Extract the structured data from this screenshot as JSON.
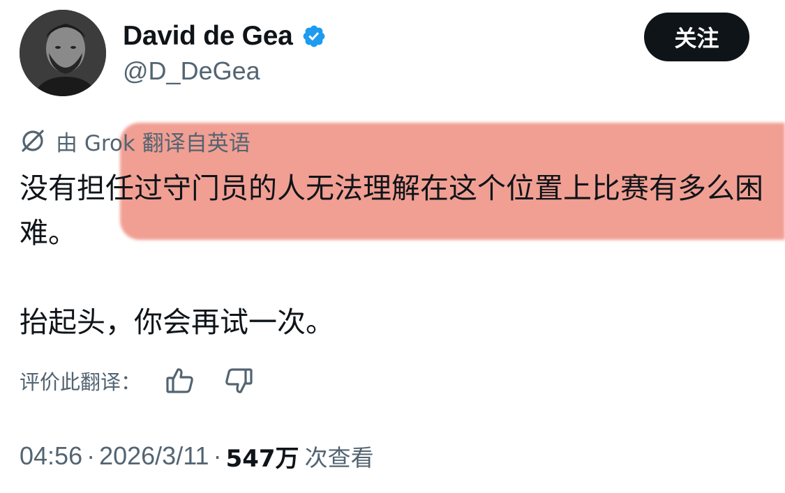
{
  "user": {
    "display_name": "David de Gea",
    "handle": "@D_DeGea",
    "verified": true,
    "avatar_icon": "avatar-photo"
  },
  "follow_button": {
    "label": "关注"
  },
  "translation": {
    "notice": "由 Grok 翻译自英语",
    "icon": "grok-icon"
  },
  "tweet": {
    "paragraphs": [
      "没有担任过守门员的人无法理解在这个位置上比赛有多么困难。",
      "抬起头，你会再试一次。"
    ]
  },
  "rating": {
    "label": "评价此翻译：",
    "up_icon": "thumbs-up-icon",
    "down_icon": "thumbs-down-icon"
  },
  "meta": {
    "time": "04:56",
    "date": "2026/3/11",
    "separator": "·",
    "views_count": "547万",
    "views_label": "次查看"
  },
  "colors": {
    "text": "#0f1419",
    "secondary": "#536471",
    "verified": "#1d9bf0",
    "highlight": "#ee8a7c",
    "button_bg": "#0f1419"
  }
}
